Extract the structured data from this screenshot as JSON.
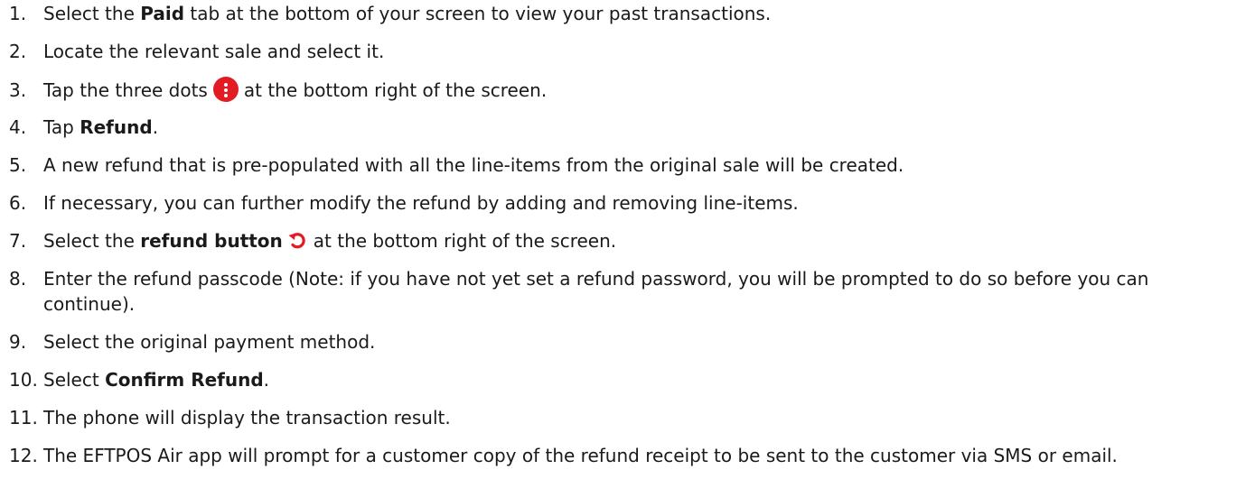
{
  "steps": [
    {
      "num": "1.",
      "pre": "Select the ",
      "bold": "Paid",
      "post": " tab at the bottom of your screen to view your past transactions."
    },
    {
      "num": "2.",
      "text": "Locate the relevant sale and select it."
    },
    {
      "num": "3.",
      "pre": "Tap the three dots",
      "icon": "vertical-dots-icon",
      "post": "at the bottom right of the screen."
    },
    {
      "num": "4.",
      "pre": "Tap ",
      "bold": "Refund",
      "post": "."
    },
    {
      "num": "5.",
      "text": "A new refund that is pre-populated with all the line-items from the original sale will be created."
    },
    {
      "num": "6.",
      "text": "If necessary, you can further modify the refund by adding and removing line-items."
    },
    {
      "num": "7.",
      "pre": "Select the ",
      "bold": "refund button",
      "icon": "refund-arrow-icon",
      "post": "at the bottom right of the screen."
    },
    {
      "num": "8.",
      "text": "Enter the refund passcode (Note: if you have not yet set a refund password, you will be prompted to do so before you can continue)."
    },
    {
      "num": "9.",
      "text": "Select the original payment method."
    },
    {
      "num": "10.",
      "pre": "Select ",
      "bold": "Confirm Refund",
      "post": "."
    },
    {
      "num": "11.",
      "text": "The phone will display the transaction result."
    },
    {
      "num": "12.",
      "text": "The EFTPOS Air app will prompt for a customer copy of the refund receipt to be sent to the customer via SMS or email."
    }
  ],
  "colors": {
    "accent": "#e31b23",
    "text": "#1a1a1a"
  }
}
